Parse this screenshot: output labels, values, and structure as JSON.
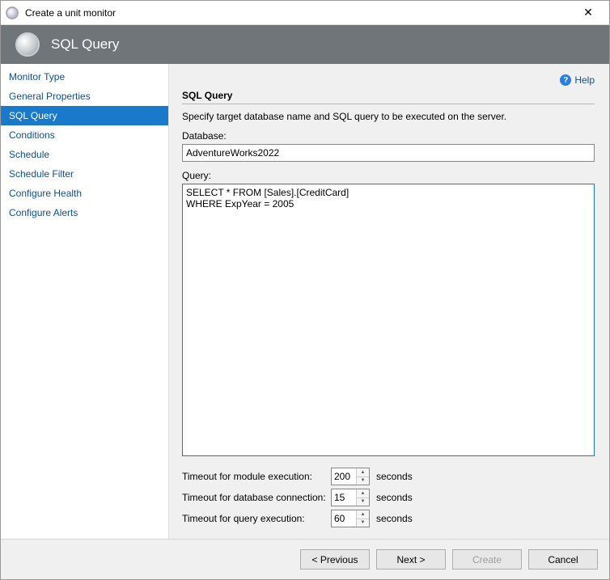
{
  "titlebar": {
    "title": "Create a unit monitor",
    "close": "✕"
  },
  "header": {
    "title": "SQL Query"
  },
  "sidebar": {
    "items": [
      {
        "label": "Monitor Type"
      },
      {
        "label": "General Properties"
      },
      {
        "label": "SQL Query"
      },
      {
        "label": "Conditions"
      },
      {
        "label": "Schedule"
      },
      {
        "label": "Schedule Filter"
      },
      {
        "label": "Configure Health"
      },
      {
        "label": "Configure Alerts"
      }
    ],
    "selectedIndex": 2
  },
  "help": {
    "label": "Help"
  },
  "form": {
    "sectionTitle": "SQL Query",
    "subtitle": "Specify target database name and SQL query to be executed on the server.",
    "databaseLabel": "Database:",
    "databaseValue": "AdventureWorks2022",
    "queryLabel": "Query:",
    "queryValue": "SELECT * FROM [Sales].[CreditCard]\nWHERE ExpYear = 2005",
    "timeouts": {
      "moduleLabel": "Timeout for module execution:",
      "moduleValue": "200",
      "dbLabel": "Timeout for database connection:",
      "dbValue": "15",
      "queryLabel": "Timeout for query execution:",
      "queryValue": "60",
      "unit": "seconds"
    }
  },
  "footer": {
    "previous": "< Previous",
    "next": "Next >",
    "create": "Create",
    "cancel": "Cancel"
  }
}
